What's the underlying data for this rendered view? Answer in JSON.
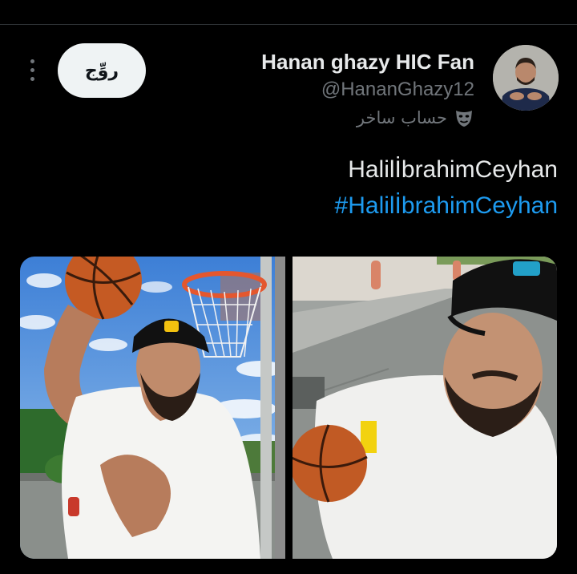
{
  "tweet": {
    "follow_button_label": "روِّج",
    "display_name": "Hanan ghazy HIC Fan",
    "handle": "@HananGhazy12",
    "parody_label": "حساب ساخر",
    "text": "HalilİbrahimCeyhan",
    "hashtag": "#HalilİbrahimCeyhan"
  },
  "media": {
    "left_photo": "Man in white t-shirt and black Brasil cap holding a basketball near a hoop",
    "right_photo": "Selfie of man in black Brasil cap holding a basketball"
  },
  "icons": {
    "more": "more-vertical-icon",
    "parody": "theater-mask-icon"
  },
  "colors": {
    "background": "#000000",
    "text_primary": "#e7e9ea",
    "text_secondary": "#71767b",
    "accent": "#1d9bf0",
    "button_bg": "#eff3f4"
  }
}
